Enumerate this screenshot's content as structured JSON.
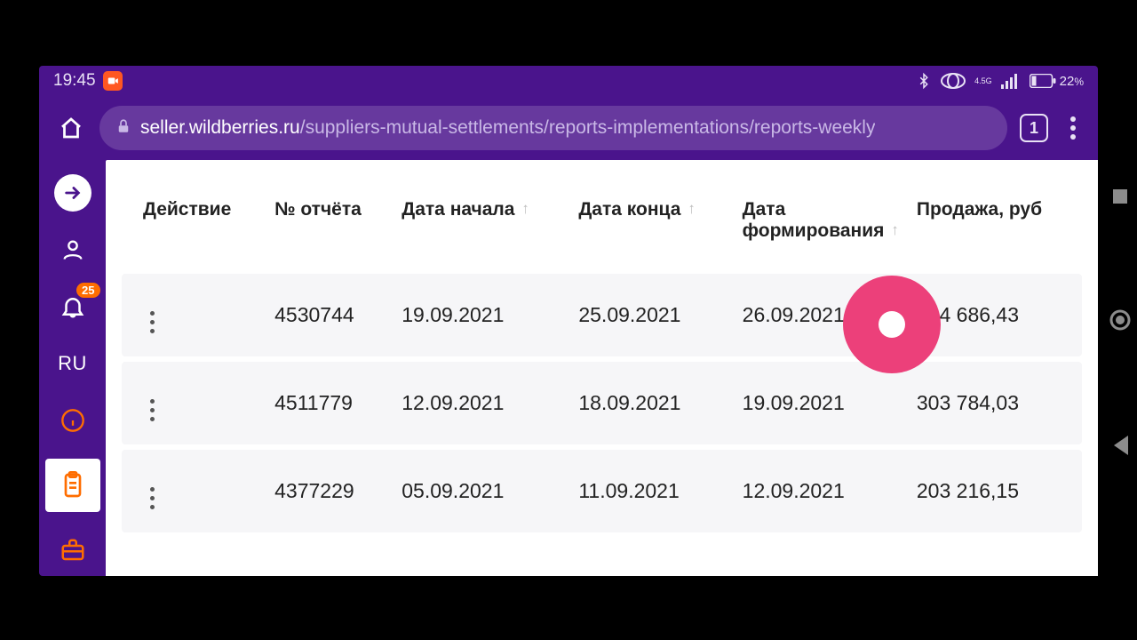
{
  "statusbar": {
    "time": "19:45",
    "battery": "22",
    "battery_suffix": "%",
    "net_label": "4.5G"
  },
  "browser": {
    "url_domain": "seller.wildberries.ru",
    "url_path": "/suppliers-mutual-settlements/reports-implementations/reports-weekly",
    "tab_count": "1"
  },
  "sidebar": {
    "notification_badge": "25",
    "language": "RU"
  },
  "table": {
    "headers": {
      "action": "Действие",
      "report_no": "№ отчёта",
      "date_start": "Дата начала",
      "date_end": "Дата конца",
      "date_formed": "Дата формирования",
      "sale": "Продажа, руб"
    },
    "rows": [
      {
        "report_no": "4530744",
        "date_start": "19.09.2021",
        "date_end": "25.09.2021",
        "date_formed": "26.09.2021",
        "sale": "304 686,43"
      },
      {
        "report_no": "4511779",
        "date_start": "12.09.2021",
        "date_end": "18.09.2021",
        "date_formed": "19.09.2021",
        "sale": "303 784,03"
      },
      {
        "report_no": "4377229",
        "date_start": "05.09.2021",
        "date_end": "11.09.2021",
        "date_formed": "12.09.2021",
        "sale": "203 216,15"
      }
    ]
  }
}
